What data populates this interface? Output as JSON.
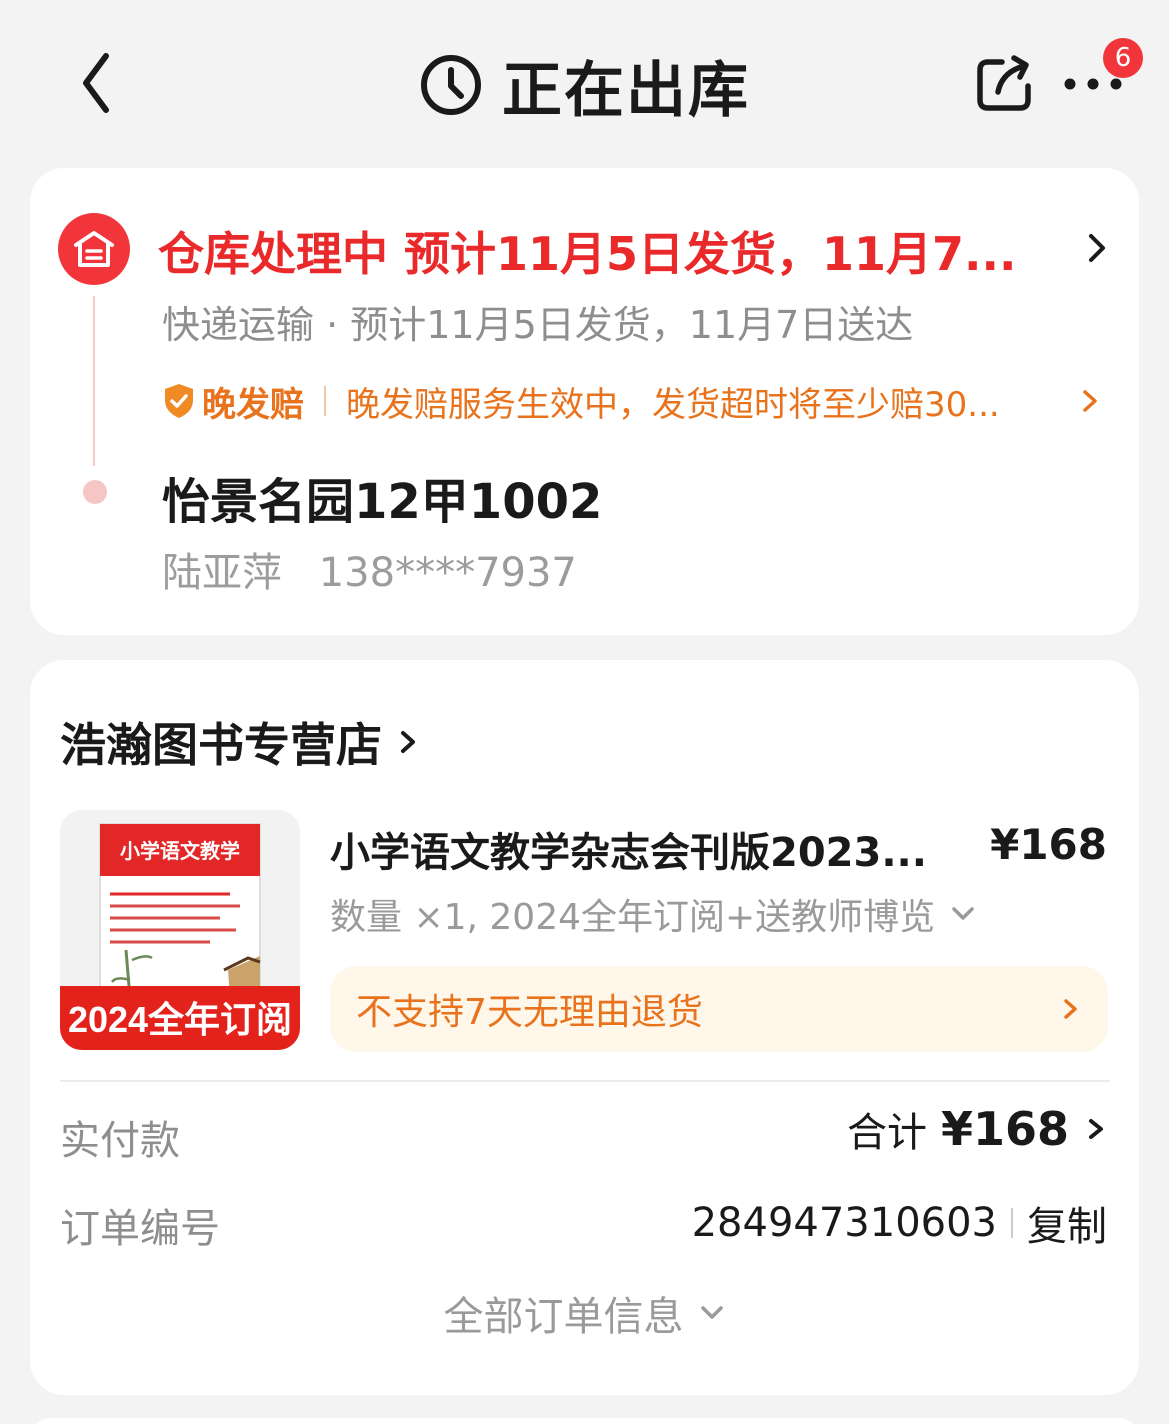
{
  "header": {
    "title": "正在出库",
    "badge_count": "6",
    "icons": {
      "back": "back-chevron-icon",
      "status": "clock-icon",
      "share": "share-icon",
      "more": "more-dots-icon"
    }
  },
  "status_card": {
    "headline": "仓库处理中  预计11月5日发货，11月7...",
    "subline": "快递运输 · 预计11月5日发货，11月7日送达",
    "late_compensation": {
      "title": "晚发赔",
      "description": "晚发赔服务生效中，发货超时将至少赔30..."
    },
    "address": {
      "line": "怡景名园12甲1002",
      "recipient_name": "陆亚萍",
      "recipient_phone": "138****7937"
    }
  },
  "order_card": {
    "shop_name": "浩瀚图书专营店",
    "product": {
      "title": "小学语文教学杂志会刊版2023...",
      "price": "¥168",
      "spec": "数量 ×1, 2024全年订阅+送教师博览",
      "image": {
        "cover_title": "小学语文教学",
        "banner": "2024全年订阅"
      },
      "return_policy": "不支持7天无理由退货"
    },
    "payment": {
      "label": "实付款",
      "prefix": "合计",
      "amount": "¥168"
    },
    "order_number": {
      "label": "订单编号",
      "value": "284947310603",
      "copy_label": "复制"
    },
    "all_info_label": "全部订单信息"
  },
  "colors": {
    "accent_red": "#ea2a2a",
    "badge_red": "#f2353a",
    "orange": "#e8731c",
    "background": "#f3f3f3"
  }
}
